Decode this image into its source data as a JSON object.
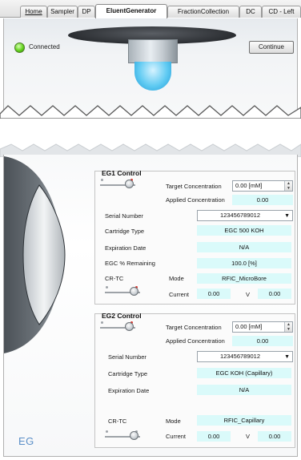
{
  "tabs": [
    {
      "label": "Home",
      "underline": "H",
      "active": false
    },
    {
      "label": "Sampler",
      "active": false
    },
    {
      "label": "DP",
      "active": false
    },
    {
      "label": "EluentGenerator",
      "active": true
    },
    {
      "label": "FractionCollection",
      "active": false
    },
    {
      "label": "DC",
      "active": false
    },
    {
      "label": "CD - Left",
      "active": false
    }
  ],
  "status": {
    "connected_label": "Connected",
    "led_color": "#63d21d"
  },
  "toolbar": {
    "continue_label": "Continue"
  },
  "panel_label": "EG",
  "eg1": {
    "title": "EG1 Control",
    "target_concentration_label": "Target Concentration",
    "target_concentration_value": "0.00 [mM]",
    "applied_concentration_label": "Applied Concentration",
    "applied_concentration_value": "0.00",
    "serial_number_label": "Serial Number",
    "serial_number_value": "123456789012",
    "cartridge_type_label": "Cartridge Type",
    "cartridge_type_value": "EGC 500 KOH",
    "expiration_date_label": "Expiration Date",
    "expiration_date_value": "N/A",
    "remaining_label": "EGC % Remaining",
    "remaining_value": "100.0 [%]",
    "crtc_label": "CR-TC",
    "mode_label": "Mode",
    "mode_value": "RFIC_MicroBore",
    "current_label": "Current",
    "current_value": "0.00",
    "voltage_unit": "V",
    "voltage_value": "0.00"
  },
  "eg2": {
    "title": "EG2 Control",
    "target_concentration_label": "Target Concentration",
    "target_concentration_value": "0.00 [mM]",
    "applied_concentration_label": "Applied Concentration",
    "applied_concentration_value": "0.00",
    "serial_number_label": "Serial Number",
    "serial_number_value": "123456789012",
    "cartridge_type_label": "Cartridge Type",
    "cartridge_type_value": "EGC KOH (Capillary)",
    "expiration_date_label": "Expiration Date",
    "expiration_date_value": "N/A",
    "crtc_label": "CR-TC",
    "mode_label": "Mode",
    "mode_value": "RFIC_Capillary",
    "current_label": "Current",
    "current_value": "0.00",
    "voltage_unit": "V",
    "voltage_value": "0.00"
  },
  "colors": {
    "field_bg": "#dafafa",
    "eg_label": "#5b8fc7",
    "slider_mark_red": "#d8342c"
  }
}
